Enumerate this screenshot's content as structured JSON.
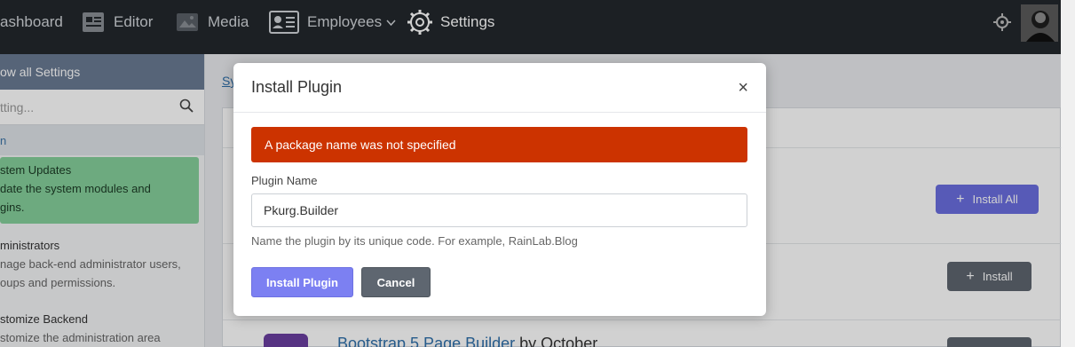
{
  "nav": {
    "items": [
      {
        "label": "ashboard"
      },
      {
        "label": "Editor"
      },
      {
        "label": "Media"
      },
      {
        "label": "Employees"
      },
      {
        "label": "Settings"
      }
    ]
  },
  "sidebar": {
    "header": "ow all Settings",
    "search_placeholder": "tting...",
    "section": "n",
    "items": [
      {
        "title": "stem Updates",
        "desc": "date the system modules and gins."
      },
      {
        "title": "ministrators",
        "desc": "nage back-end administrator users, oups and permissions."
      },
      {
        "title": "stomize Backend",
        "desc": "stomize the administration area"
      }
    ]
  },
  "main": {
    "breadcrumb": "Sy",
    "install_all_label": "Install All",
    "install_label": "Install",
    "plugin_link": "Bootstrap 5 Page Builder",
    "plugin_by": "by October"
  },
  "modal": {
    "title": "Install Plugin",
    "close": "×",
    "alert": "A package name was not specified",
    "field_label": "Plugin Name",
    "field_value": "Pkurg.Builder",
    "help": "Name the plugin by its unique code. For example, RainLab.Blog",
    "install_button": "Install Plugin",
    "cancel_button": "Cancel"
  },
  "colors": {
    "nav_bg": "#23282d",
    "alert_bg": "#cc3300",
    "primary": "#7c80f2",
    "secondary": "#5e6670",
    "active_item": "#86d09b"
  }
}
